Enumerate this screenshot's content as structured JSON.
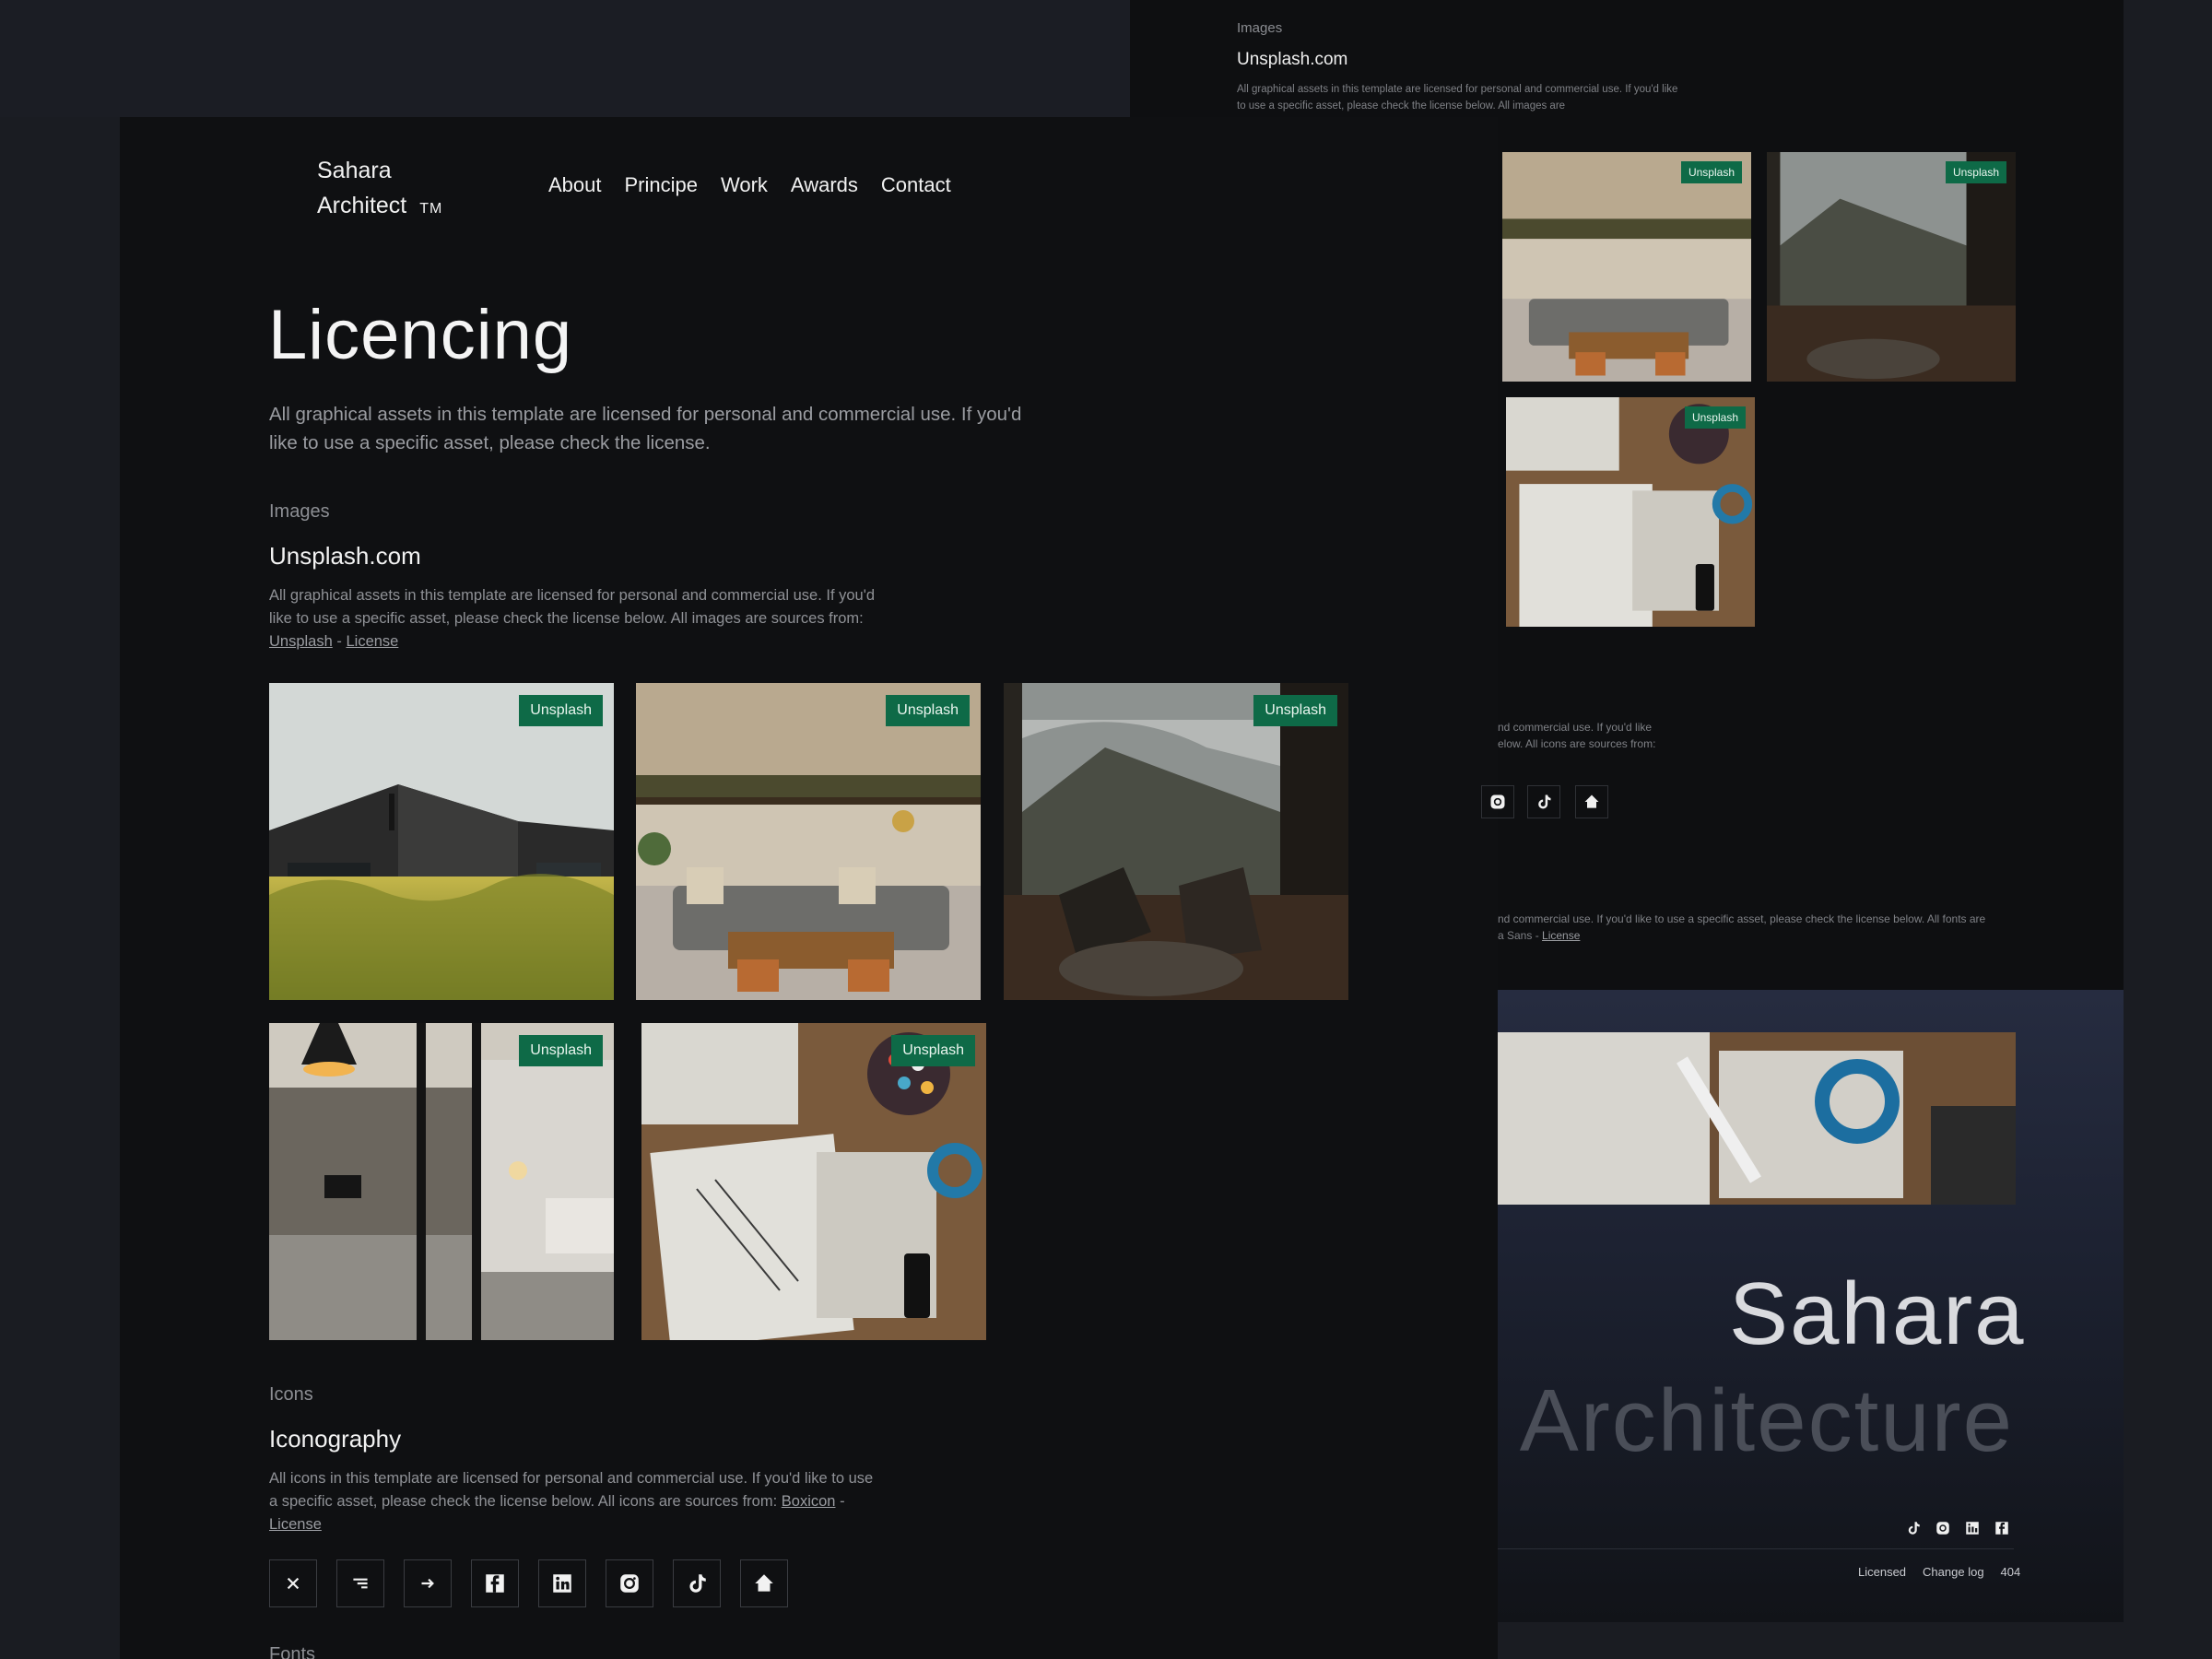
{
  "brand": {
    "line1": "Sahara",
    "line2": "Architect",
    "tm": "TM"
  },
  "nav": [
    "About",
    "Principe",
    "Work",
    "Awards",
    "Contact"
  ],
  "page": {
    "title": "Licencing",
    "lead": "All graphical assets in this template are licensed for personal and commercial use. If you'd like to use a specific asset, please check the license."
  },
  "images_section": {
    "kicker": "Images",
    "title": "Unsplash.com",
    "body": "All graphical assets in this template are licensed for personal and commercial use. If you'd like to use a specific asset, please check the license below. All images are sources from:",
    "link1": "Unsplash",
    "sep": "-",
    "link2": "License",
    "badge": "Unsplash"
  },
  "icons_section": {
    "kicker": "Icons",
    "title": "Iconography",
    "body": "All icons in this template are licensed for personal and commercial use. If you'd like to use a specific asset, please check the  license below. All icons are sources from:",
    "link1": "Boxicon",
    "sep": "-",
    "link2": "License",
    "icons": [
      "close-icon",
      "menu-lines-icon",
      "arrow-right-icon",
      "facebook-icon",
      "linkedin-icon",
      "instagram-icon",
      "tiktok-icon",
      "home-icon"
    ]
  },
  "fonts_section": {
    "kicker": "Fonts"
  },
  "right": {
    "kicker": "Images",
    "title": "Unsplash.com",
    "body": "All graphical assets in this template are licensed for personal and commercial use. If you'd like to use a specific asset, please check the license below. All images are",
    "icons_text1": "nd commercial use. If you'd like",
    "icons_text2": "elow. All icons are sources from:",
    "fonts_text1": "nd commercial use. If you'd like to use a specific asset, please check the  license below. All fonts are",
    "fonts_text2": "a Sans -",
    "fonts_link": "License",
    "hero_line1": "Sahara",
    "hero_line2": "Architecture",
    "footer_links": [
      "Licensed",
      "Change log",
      "404"
    ]
  },
  "colors": {
    "badge": "#0e6a47",
    "bg": "#0f1012",
    "panel": "#1b1d24"
  }
}
